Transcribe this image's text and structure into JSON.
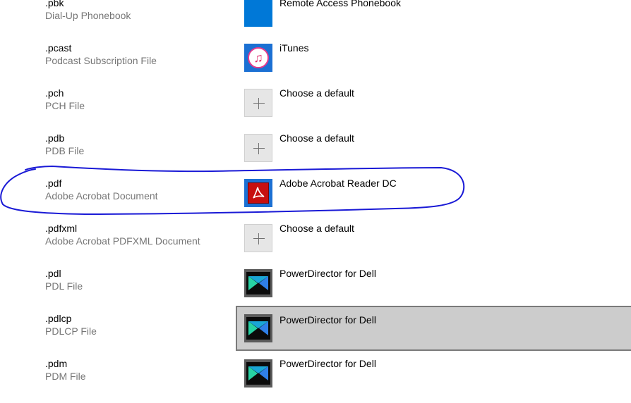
{
  "rows": [
    {
      "ext": ".pbk",
      "desc": "Dial-Up Phonebook",
      "app": "Remote Access Phonebook",
      "icon": "blue-tile-icon"
    },
    {
      "ext": ".pcast",
      "desc": "Podcast Subscription File",
      "app": "iTunes",
      "icon": "itunes-icon"
    },
    {
      "ext": ".pch",
      "desc": "PCH File",
      "app": "Choose a default",
      "icon": "plus-icon"
    },
    {
      "ext": ".pdb",
      "desc": "PDB File",
      "app": "Choose a default",
      "icon": "plus-icon"
    },
    {
      "ext": ".pdf",
      "desc": "Adobe Acrobat Document",
      "app": "Adobe Acrobat Reader DC",
      "icon": "acrobat-reader-icon"
    },
    {
      "ext": ".pdfxml",
      "desc": "Adobe Acrobat PDFXML Document",
      "app": "Choose a default",
      "icon": "plus-icon"
    },
    {
      "ext": ".pdl",
      "desc": "PDL File",
      "app": "PowerDirector for Dell",
      "icon": "powerdirector-icon"
    },
    {
      "ext": ".pdlcp",
      "desc": "PDLCP File",
      "app": "PowerDirector for Dell",
      "icon": "powerdirector-icon",
      "selected": true
    },
    {
      "ext": ".pdm",
      "desc": "PDM File",
      "app": "PowerDirector for Dell",
      "icon": "powerdirector-icon"
    }
  ],
  "colors": {
    "annotation_ink": "#1a1ad6",
    "selected_bg": "#cccccc",
    "selected_border": "#7a7a7a",
    "secondary_text": "#767676",
    "windows_blue": "#0078d7"
  }
}
